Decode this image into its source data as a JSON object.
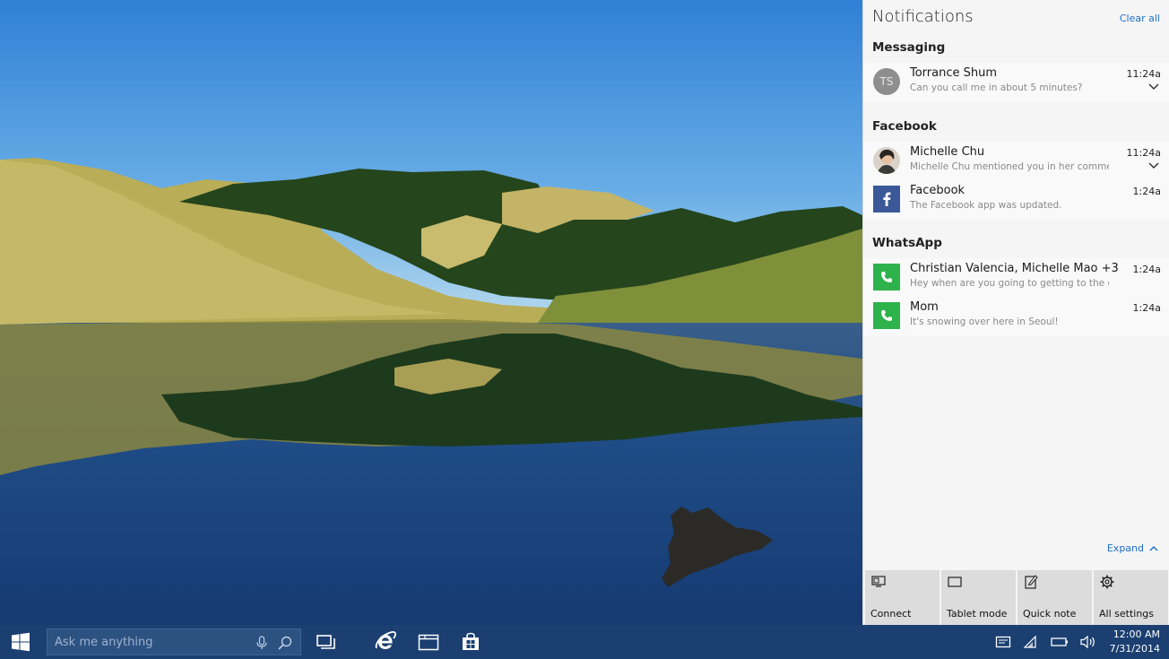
{
  "action_center": {
    "title": "Notifications",
    "clear_all": "Clear all",
    "groups": [
      {
        "header": "Messaging",
        "items": [
          {
            "name": "Torrance Shum",
            "message": "Can you call me in about 5 minutes?",
            "time": "11:24a",
            "avatar_initials": "TS",
            "icon": "person-avatar"
          }
        ]
      },
      {
        "header": "Facebook",
        "items": [
          {
            "name": "Michelle Chu",
            "message": "Michelle Chu mentioned you in her comment",
            "time": "11:24a",
            "icon": "profile-photo"
          },
          {
            "name": "Facebook",
            "message": "The Facebook app was updated.",
            "time": "1:24a",
            "icon": "facebook-icon"
          }
        ]
      },
      {
        "header": "WhatsApp",
        "items": [
          {
            "name": "Christian Valencia, Michelle Mao +3",
            "message": "Hey when are you going to getting to the con",
            "time": "1:24a",
            "icon": "whatsapp-phone-icon"
          },
          {
            "name": "Mom",
            "message": "It's snowing over here in Seoul!",
            "time": "1:24a",
            "icon": "whatsapp-phone-icon"
          }
        ]
      }
    ],
    "expand": "Expand",
    "quick_actions": [
      {
        "label": "Connect",
        "icon": "connect-icon"
      },
      {
        "label": "Tablet mode",
        "icon": "tablet-mode-icon"
      },
      {
        "label": "Quick note",
        "icon": "quick-note-icon"
      },
      {
        "label": "All settings",
        "icon": "gear-icon"
      }
    ]
  },
  "taskbar": {
    "search_placeholder": "Ask me anything",
    "clock_time": "12:00 AM",
    "clock_date": "7/31/2014",
    "pinned": [
      "task-view-icon",
      "internet-explorer-icon",
      "file-explorer-icon",
      "store-icon"
    ],
    "tray": [
      "action-center-icon",
      "network-icon",
      "battery-icon",
      "volume-icon"
    ]
  },
  "colors": {
    "taskbar": "#1b3f70",
    "accent_link": "#1f6fc8",
    "facebook": "#3b5998",
    "whatsapp": "#2eb24c",
    "panel_bg": "#f5f5f5"
  }
}
